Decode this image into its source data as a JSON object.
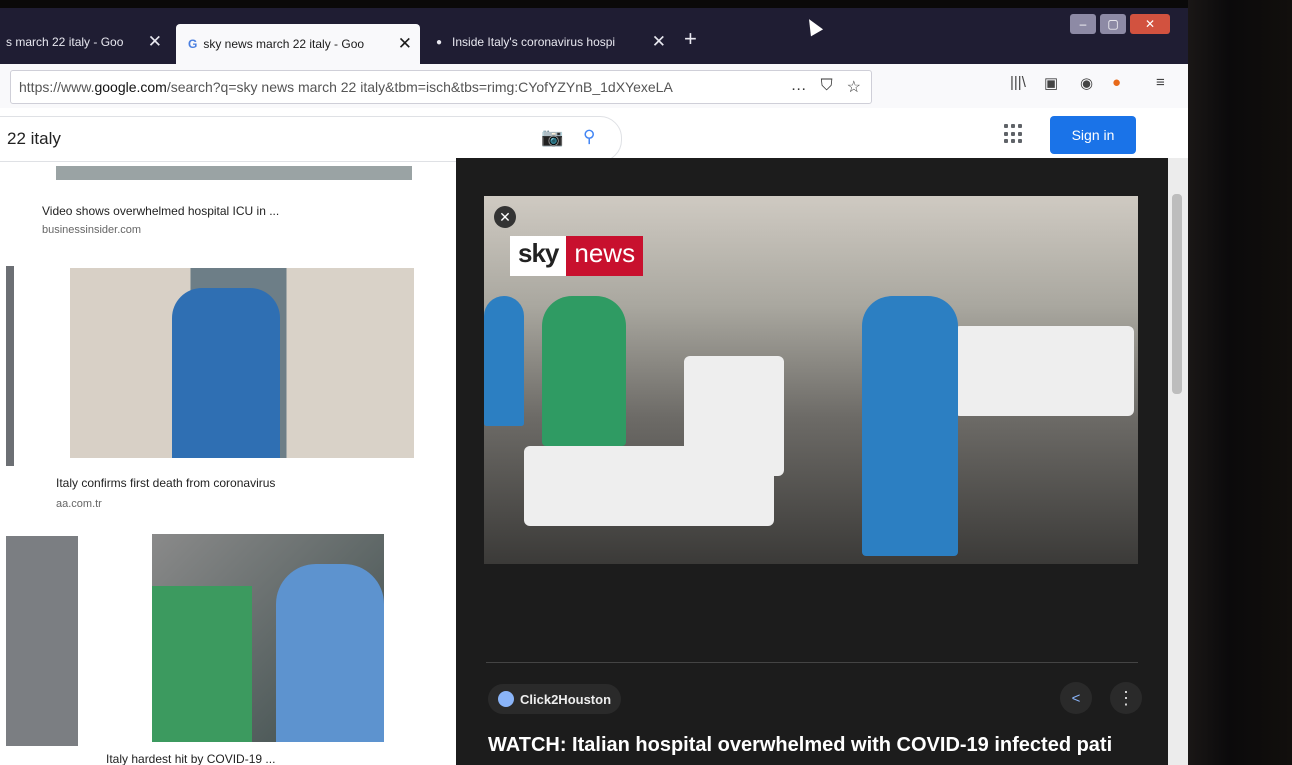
{
  "browser": {
    "tabs": [
      {
        "label": "s march 22 italy - Goo",
        "icon": "none"
      },
      {
        "label": "sky news march 22 italy - Goo",
        "icon": "G"
      },
      {
        "label": "Inside Italy's coronavirus hospi",
        "icon": "dot"
      }
    ],
    "new_tab": "+",
    "url_prefix": "https://www.",
    "url_domain": "google.com",
    "url_rest": "/search?q=sky news march 22 italy&tbm=isch&tbs=rimg:CYofYZYnB_1dXYexeLA",
    "url_icons": [
      "…",
      "pocket-icon",
      "star-icon"
    ],
    "toolbar_icons": [
      "library-icon",
      "sidebar-icon",
      "account-icon",
      "extension-icon",
      "menu-icon"
    ],
    "window_controls": [
      "–",
      "▢",
      "✕"
    ]
  },
  "google": {
    "search_query": "22 italy",
    "signin_label": "Sign in"
  },
  "results": [
    {
      "caption": "Video shows overwhelmed hospital ICU in ...",
      "source": "businessinsider.com"
    },
    {
      "caption": "Italy confirms first death from coronavirus",
      "source": "aa.com.tr"
    },
    {
      "caption": "Italy hardest hit by COVID-19 ...",
      "source": ""
    }
  ],
  "preview": {
    "logo_sky": "sky",
    "logo_news": "news",
    "source_name": "Click2Houston",
    "title": "WATCH: Italian hospital overwhelmed with COVID-19 infected pati",
    "close_label": "✕",
    "share_label": "<",
    "more_label": "⋮"
  },
  "colors": {
    "signin": "#1a73e8",
    "tabbar": "#1f1d33",
    "panel": "#1c1c1c",
    "news_red": "#c8102e"
  }
}
